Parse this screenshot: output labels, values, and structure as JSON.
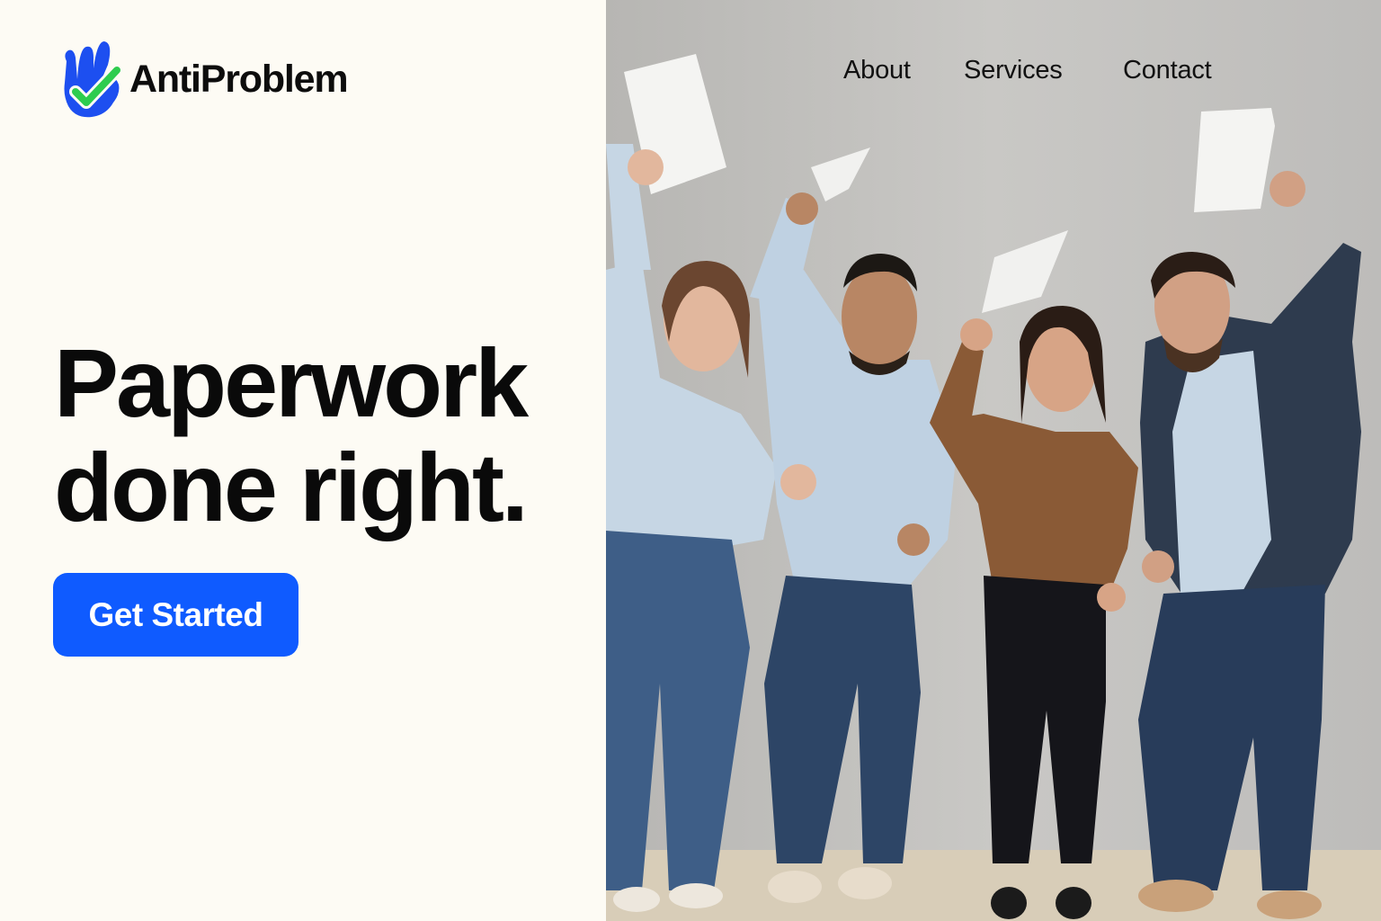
{
  "brand": {
    "name": "AntiProblem",
    "logo_icon": "hand-checkmark-icon",
    "logo_colors": {
      "hand": "#1d4ff0",
      "check": "#2ecc4e"
    }
  },
  "nav": {
    "items": [
      {
        "label": "About"
      },
      {
        "label": "Services"
      },
      {
        "label": "Contact"
      }
    ]
  },
  "hero": {
    "headline_line1": "Paperwork",
    "headline_line2": "done right.",
    "cta_label": "Get Started",
    "photo": "team-celebrating-with-papers-photo"
  },
  "colors": {
    "accent": "#0f5bff",
    "background": "#fdfbf4",
    "text": "#0a0a0a"
  }
}
